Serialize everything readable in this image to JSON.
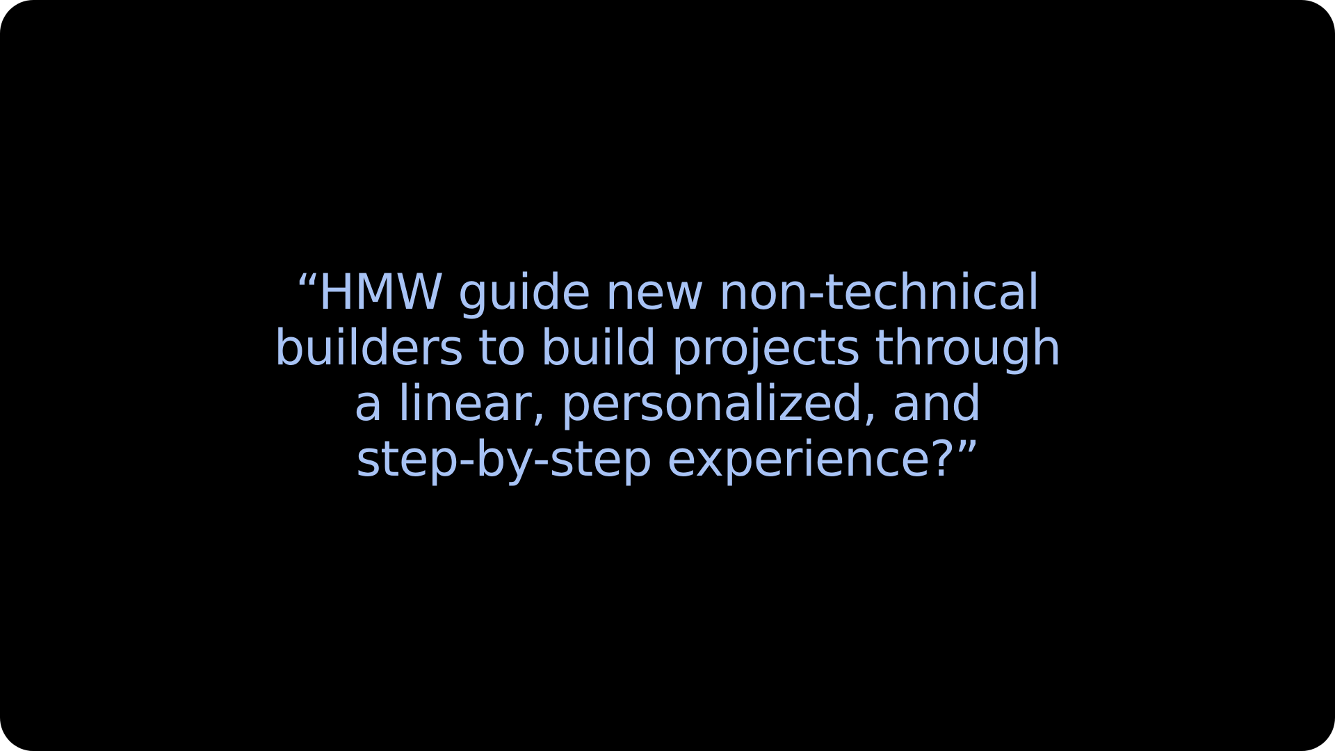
{
  "slide": {
    "background_color": "#000000",
    "text_color": "#a8c3f5",
    "quote_lines": [
      "“HMW guide new non-technical",
      "builders to build projects through",
      "a linear, personalized, and",
      "step-by-step experience?”"
    ]
  }
}
